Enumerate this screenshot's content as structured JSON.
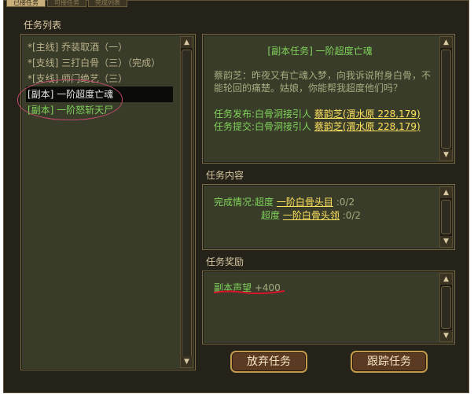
{
  "tabs": [
    "已接任务",
    "可接任务",
    "完成列表"
  ],
  "task_list": {
    "title": "任务列表",
    "items": [
      {
        "text": "*[主线] 乔装取酒（一）",
        "state": "done"
      },
      {
        "text": "*[支线] 三打白骨（三）（完成）",
        "state": "done"
      },
      {
        "text": "*[支线] 师门绝艺（三）",
        "state": "done"
      },
      {
        "text": "[副本] 一阶超度亡魂",
        "state": "selected"
      },
      {
        "text": "[副本] 一阶怒斩天尸",
        "state": "dungeon"
      }
    ]
  },
  "detail": {
    "title": "[副本任务]   一阶超度亡魂",
    "dialog": "蔡韵芝：昨夜又有亡魂入梦，向我诉说附身白骨，不能轮回的痛楚。姑娘，你能帮我超度他们吗？",
    "issue_label": "任务发布:白骨洞接引人",
    "issue_npc": "蔡韵芝(渭水原 228,179)",
    "submit_label": "任务提交:白骨洞接引人",
    "submit_npc": "蔡韵芝(渭水原 228,179)"
  },
  "content": {
    "title": "任务内容",
    "progress_label": "完成情况:",
    "rows": [
      {
        "verb": "超度",
        "target": "一阶白骨头目",
        "count": ":0/2"
      },
      {
        "verb": "超度",
        "target": "一阶白骨头领",
        "count": ":0/2"
      }
    ]
  },
  "reward": {
    "title": "任务奖励",
    "item": "副本声望",
    "value": "+400"
  },
  "buttons": {
    "abandon": "放弃任务",
    "track": "跟踪任务"
  }
}
